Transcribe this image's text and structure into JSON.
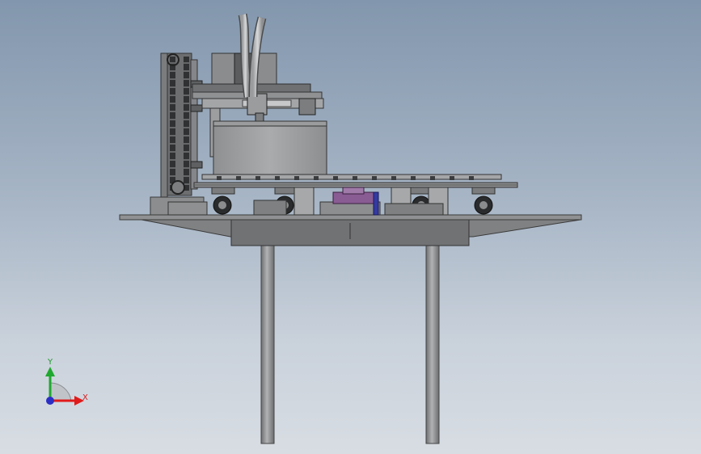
{
  "triad": {
    "x_label": "X",
    "y_label": "Y",
    "x_color": "#e01b1b",
    "y_color": "#1fa830",
    "z_color": "#2b2fc4",
    "x_icon": "x-axis-arrow-icon",
    "y_icon": "y-axis-arrow-icon",
    "z_icon": "z-axis-origin-icon"
  },
  "model": {
    "name": "machine-assembly",
    "steel_color": "#8a8c8e",
    "dark_color": "#3e4042",
    "accent_color": "#8a5c94"
  }
}
